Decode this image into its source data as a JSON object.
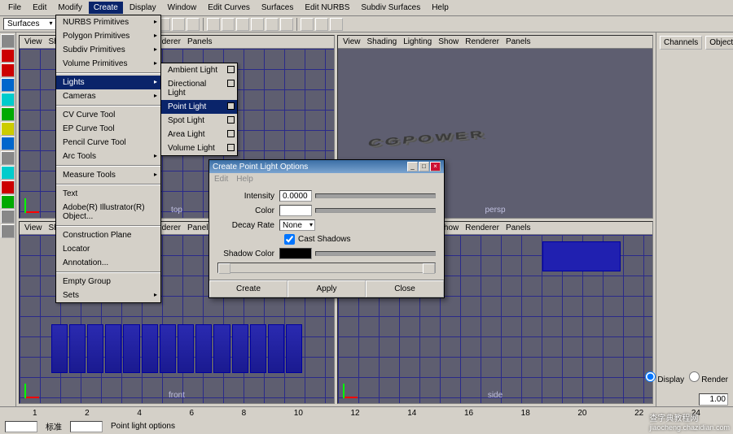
{
  "menubar": [
    "File",
    "Edit",
    "Modify",
    "Create",
    "Display",
    "Window",
    "Edit Curves",
    "Surfaces",
    "Edit NURBS",
    "Subdiv Surfaces",
    "Help"
  ],
  "menubar_active": 3,
  "shelf_selector": "Surfaces",
  "create_menu": {
    "groups": [
      [
        "NURBS Primitives",
        "Polygon Primitives",
        "Subdiv Primitives",
        "Volume Primitives"
      ],
      [
        "Lights",
        "Cameras"
      ],
      [
        "CV Curve Tool",
        "EP Curve Tool",
        "Pencil Curve Tool",
        "Arc Tools"
      ],
      [
        "Measure Tools"
      ],
      [
        "Text",
        "Adobe(R) Illustrator(R) Object..."
      ],
      [
        "Construction Plane",
        "Locator",
        "Annotation..."
      ],
      [
        "Empty Group",
        "Sets"
      ]
    ],
    "highlighted": "Lights",
    "arrows": [
      "NURBS Primitives",
      "Polygon Primitives",
      "Subdiv Primitives",
      "Volume Primitives",
      "Lights",
      "Cameras",
      "Arc Tools",
      "Measure Tools",
      "Sets"
    ]
  },
  "lights_submenu": {
    "items": [
      "Ambient Light",
      "Directional Light",
      "Point Light",
      "Spot Light",
      "Area Light",
      "Volume Light"
    ],
    "highlighted": "Point Light"
  },
  "viewport_menu": [
    "View",
    "Shading",
    "Lighting",
    "Show",
    "Renderer",
    "Panels"
  ],
  "viewport_labels": {
    "tl": "top",
    "tr": "persp",
    "bl": "front",
    "br": "side"
  },
  "scene_text": "CGPOWER",
  "right_panel": {
    "tabs": [
      "Channels",
      "Object"
    ],
    "display": "Display",
    "render": "Render"
  },
  "dialog": {
    "title": "Create Point Light Options",
    "menu": [
      "Edit",
      "Help"
    ],
    "fields": {
      "intensity_lbl": "Intensity",
      "intensity_val": "0.0000",
      "color_lbl": "Color",
      "decay_lbl": "Decay Rate",
      "decay_val": "None",
      "castshadows_lbl": "Cast Shadows",
      "shadowcolor_lbl": "Shadow Color"
    },
    "buttons": {
      "create": "Create",
      "apply": "Apply",
      "close": "Close"
    }
  },
  "timeline_ticks": [
    "1",
    "2",
    "4",
    "6",
    "8",
    "10",
    "12",
    "14",
    "16",
    "18",
    "20",
    "22",
    "24"
  ],
  "timeline_chinese": "标准",
  "frame_end": "1.00",
  "status_text": "Point light options",
  "watermark": {
    "main": "查字典教程网",
    "sub": "jiaocheng.chazidian.com"
  }
}
